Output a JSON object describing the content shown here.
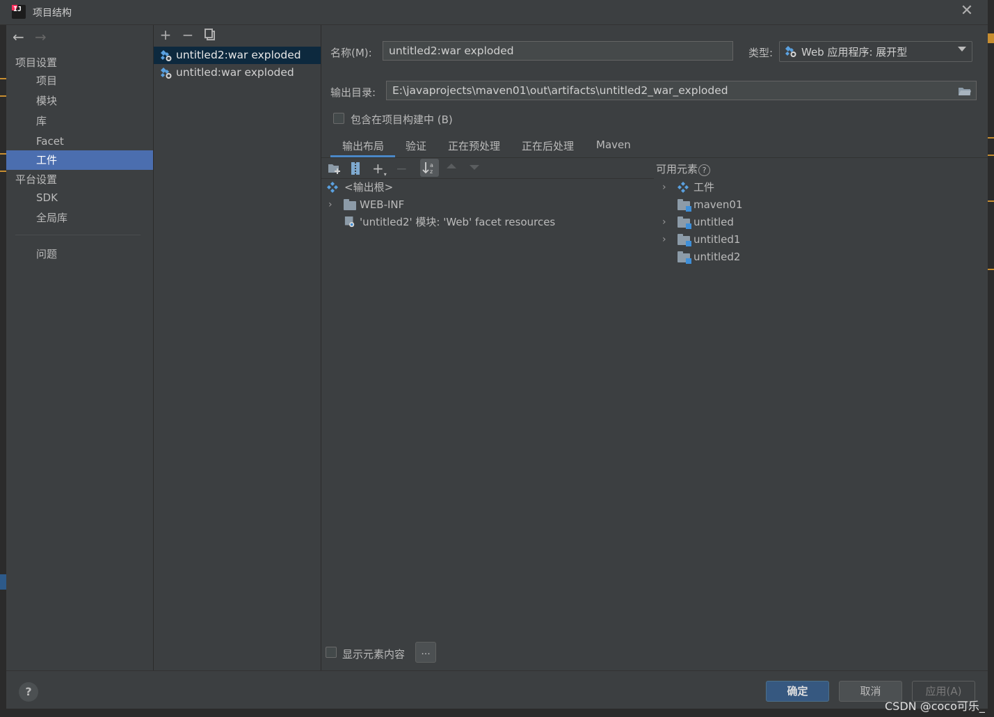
{
  "window": {
    "title": "项目结构"
  },
  "nav": {
    "project_settings_header": "项目设置",
    "project_items": [
      "项目",
      "模块",
      "库",
      "Facet",
      "工件"
    ],
    "selected_index": 4,
    "platform_settings_header": "平台设置",
    "platform_items": [
      "SDK",
      "全局库"
    ],
    "problems": "问题"
  },
  "artifacts": {
    "items": [
      {
        "name": "untitled2:war exploded",
        "selected": true
      },
      {
        "name": "untitled:war exploded",
        "selected": false
      }
    ]
  },
  "form": {
    "name_label": "名称(M):",
    "name_value": "untitled2:war exploded",
    "type_label": "类型:",
    "type_value": "Web 应用程序: 展开型",
    "output_dir_label": "输出目录:",
    "output_dir_value": "E:\\javaprojects\\maven01\\out\\artifacts\\untitled2_war_exploded",
    "include_in_build_label": "包含在项目构建中 (B)",
    "include_in_build_checked": false
  },
  "tabs": [
    "输出布局",
    "验证",
    "正在预处理",
    "正在后处理",
    "Maven"
  ],
  "active_tab": 0,
  "layout_tree": [
    {
      "label": "<输出根>",
      "kind": "artifact-root"
    },
    {
      "label": "WEB-INF",
      "kind": "folder",
      "expandable": true
    },
    {
      "label": "'untitled2' 模块: 'Web' facet resources",
      "kind": "facet-resource"
    }
  ],
  "available": {
    "label": "可用元素",
    "items": [
      {
        "label": "工件",
        "kind": "artifacts",
        "expandable": true
      },
      {
        "label": "maven01",
        "kind": "module",
        "expandable": false
      },
      {
        "label": "untitled",
        "kind": "module",
        "expandable": true
      },
      {
        "label": "untitled1",
        "kind": "module",
        "expandable": true
      },
      {
        "label": "untitled2",
        "kind": "module",
        "expandable": false
      }
    ]
  },
  "show_content_label": "显示元素内容",
  "ellipsis_label": "...",
  "footer": {
    "help": "?",
    "ok": "确定",
    "cancel": "取消",
    "apply": "应用(A)"
  },
  "watermark": "CSDN @coco可乐_",
  "colors": {
    "accent_selected": "#4b6eaf",
    "list_selected": "#0d293e",
    "tab_underline": "#4a88c7",
    "ok_button": "#365880"
  }
}
